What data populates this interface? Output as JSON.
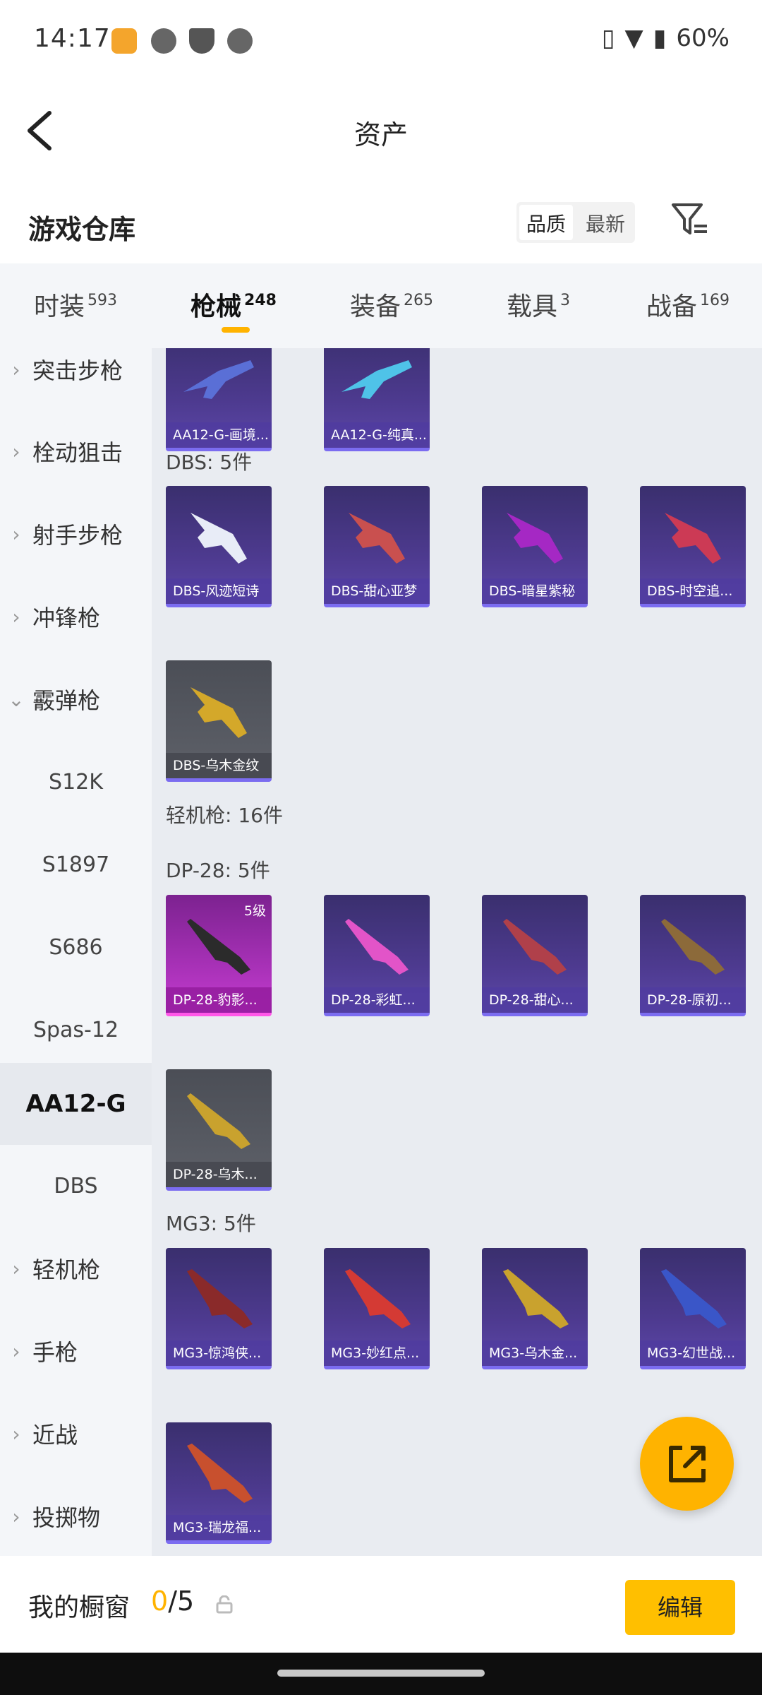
{
  "status_bar": {
    "time": "14:17",
    "battery": "60%"
  },
  "header": {
    "title": "资产"
  },
  "section": {
    "title": "游戏仓库",
    "sort_quality": "品质",
    "sort_newest": "最新"
  },
  "tabs": [
    {
      "label": "时装",
      "count": "593"
    },
    {
      "label": "枪械",
      "count": "248"
    },
    {
      "label": "装备",
      "count": "265"
    },
    {
      "label": "载具",
      "count": "3"
    },
    {
      "label": "战备",
      "count": "169"
    }
  ],
  "sidebar": [
    {
      "label": "突击步枪"
    },
    {
      "label": "栓动狙击"
    },
    {
      "label": "射手步枪"
    },
    {
      "label": "冲锋枪"
    },
    {
      "label": "霰弹枪"
    },
    {
      "label": "S12K"
    },
    {
      "label": "S1897"
    },
    {
      "label": "S686"
    },
    {
      "label": "Spas-12"
    },
    {
      "label": "AA12-G"
    },
    {
      "label": "DBS"
    },
    {
      "label": "轻机枪"
    },
    {
      "label": "手枪"
    },
    {
      "label": "近战"
    },
    {
      "label": "投掷物"
    }
  ],
  "content": {
    "aa12_items": [
      "AA12-G-画境...",
      "AA12-G-纯真..."
    ],
    "dbs_label": "DBS: 5件",
    "dbs_items": [
      "DBS-风迹短诗",
      "DBS-甜心亚梦",
      "DBS-暗星紫秘",
      "DBS-时空追...",
      "DBS-乌木金纹"
    ],
    "lmg_label": "轻机枪: 16件",
    "dp28_label": "DP-28: 5件",
    "dp28_items": [
      "DP-28-豹影...",
      "DP-28-彩虹...",
      "DP-28-甜心...",
      "DP-28-原初...",
      "DP-28-乌木..."
    ],
    "dp28_level": "5级",
    "mg3_label": "MG3: 5件",
    "mg3_items": [
      "MG3-惊鸿侠...",
      "MG3-妙红点...",
      "MG3-乌木金...",
      "MG3-幻世战...",
      "MG3-瑞龙福..."
    ]
  },
  "bottom_bar": {
    "label": "我的橱窗",
    "count_current": "0",
    "count_total": "/5",
    "edit": "编辑"
  },
  "colors": {
    "accent": "#ffb300",
    "card_purple": "#4d3a8f",
    "card_pink": "#c43bd0"
  }
}
